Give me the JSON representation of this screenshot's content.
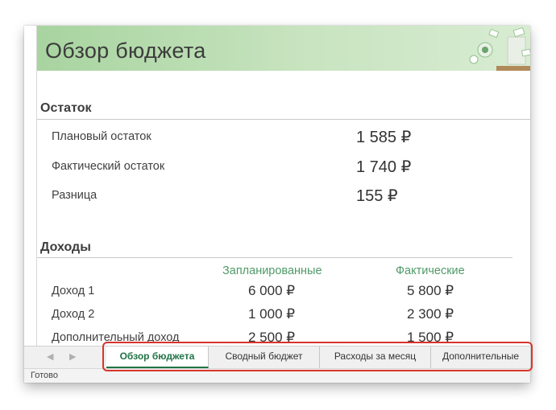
{
  "banner": {
    "title": "Обзор бюджета"
  },
  "balance": {
    "heading": "Остаток",
    "rows": [
      {
        "label": "Плановый остаток",
        "value": "1 585 ₽"
      },
      {
        "label": "Фактический остаток",
        "value": "1 740 ₽"
      },
      {
        "label": "Разница",
        "value": "155 ₽"
      }
    ]
  },
  "income": {
    "heading": "Доходы",
    "col_planned": "Запланированные",
    "col_actual": "Фактические",
    "rows": [
      {
        "label": "Доход 1",
        "planned": "6 000 ₽",
        "actual": "5 800 ₽"
      },
      {
        "label": "Доход 2",
        "planned": "1 000 ₽",
        "actual": "2 300 ₽"
      },
      {
        "label": "Дополнительный доход",
        "planned": "2 500 ₽",
        "actual": "1 500 ₽"
      }
    ]
  },
  "tabs": {
    "prev_arrow": "◀",
    "next_arrow": "▶",
    "items": [
      "Обзор бюджета",
      "Сводный бюджет",
      "Расходы за месяц",
      "Дополнительные"
    ],
    "active_index": 0
  },
  "status": {
    "text": "Готово"
  },
  "colors": {
    "accent_green": "#217346",
    "highlight_red": "#d9342b",
    "column_green": "#4f9a68"
  }
}
